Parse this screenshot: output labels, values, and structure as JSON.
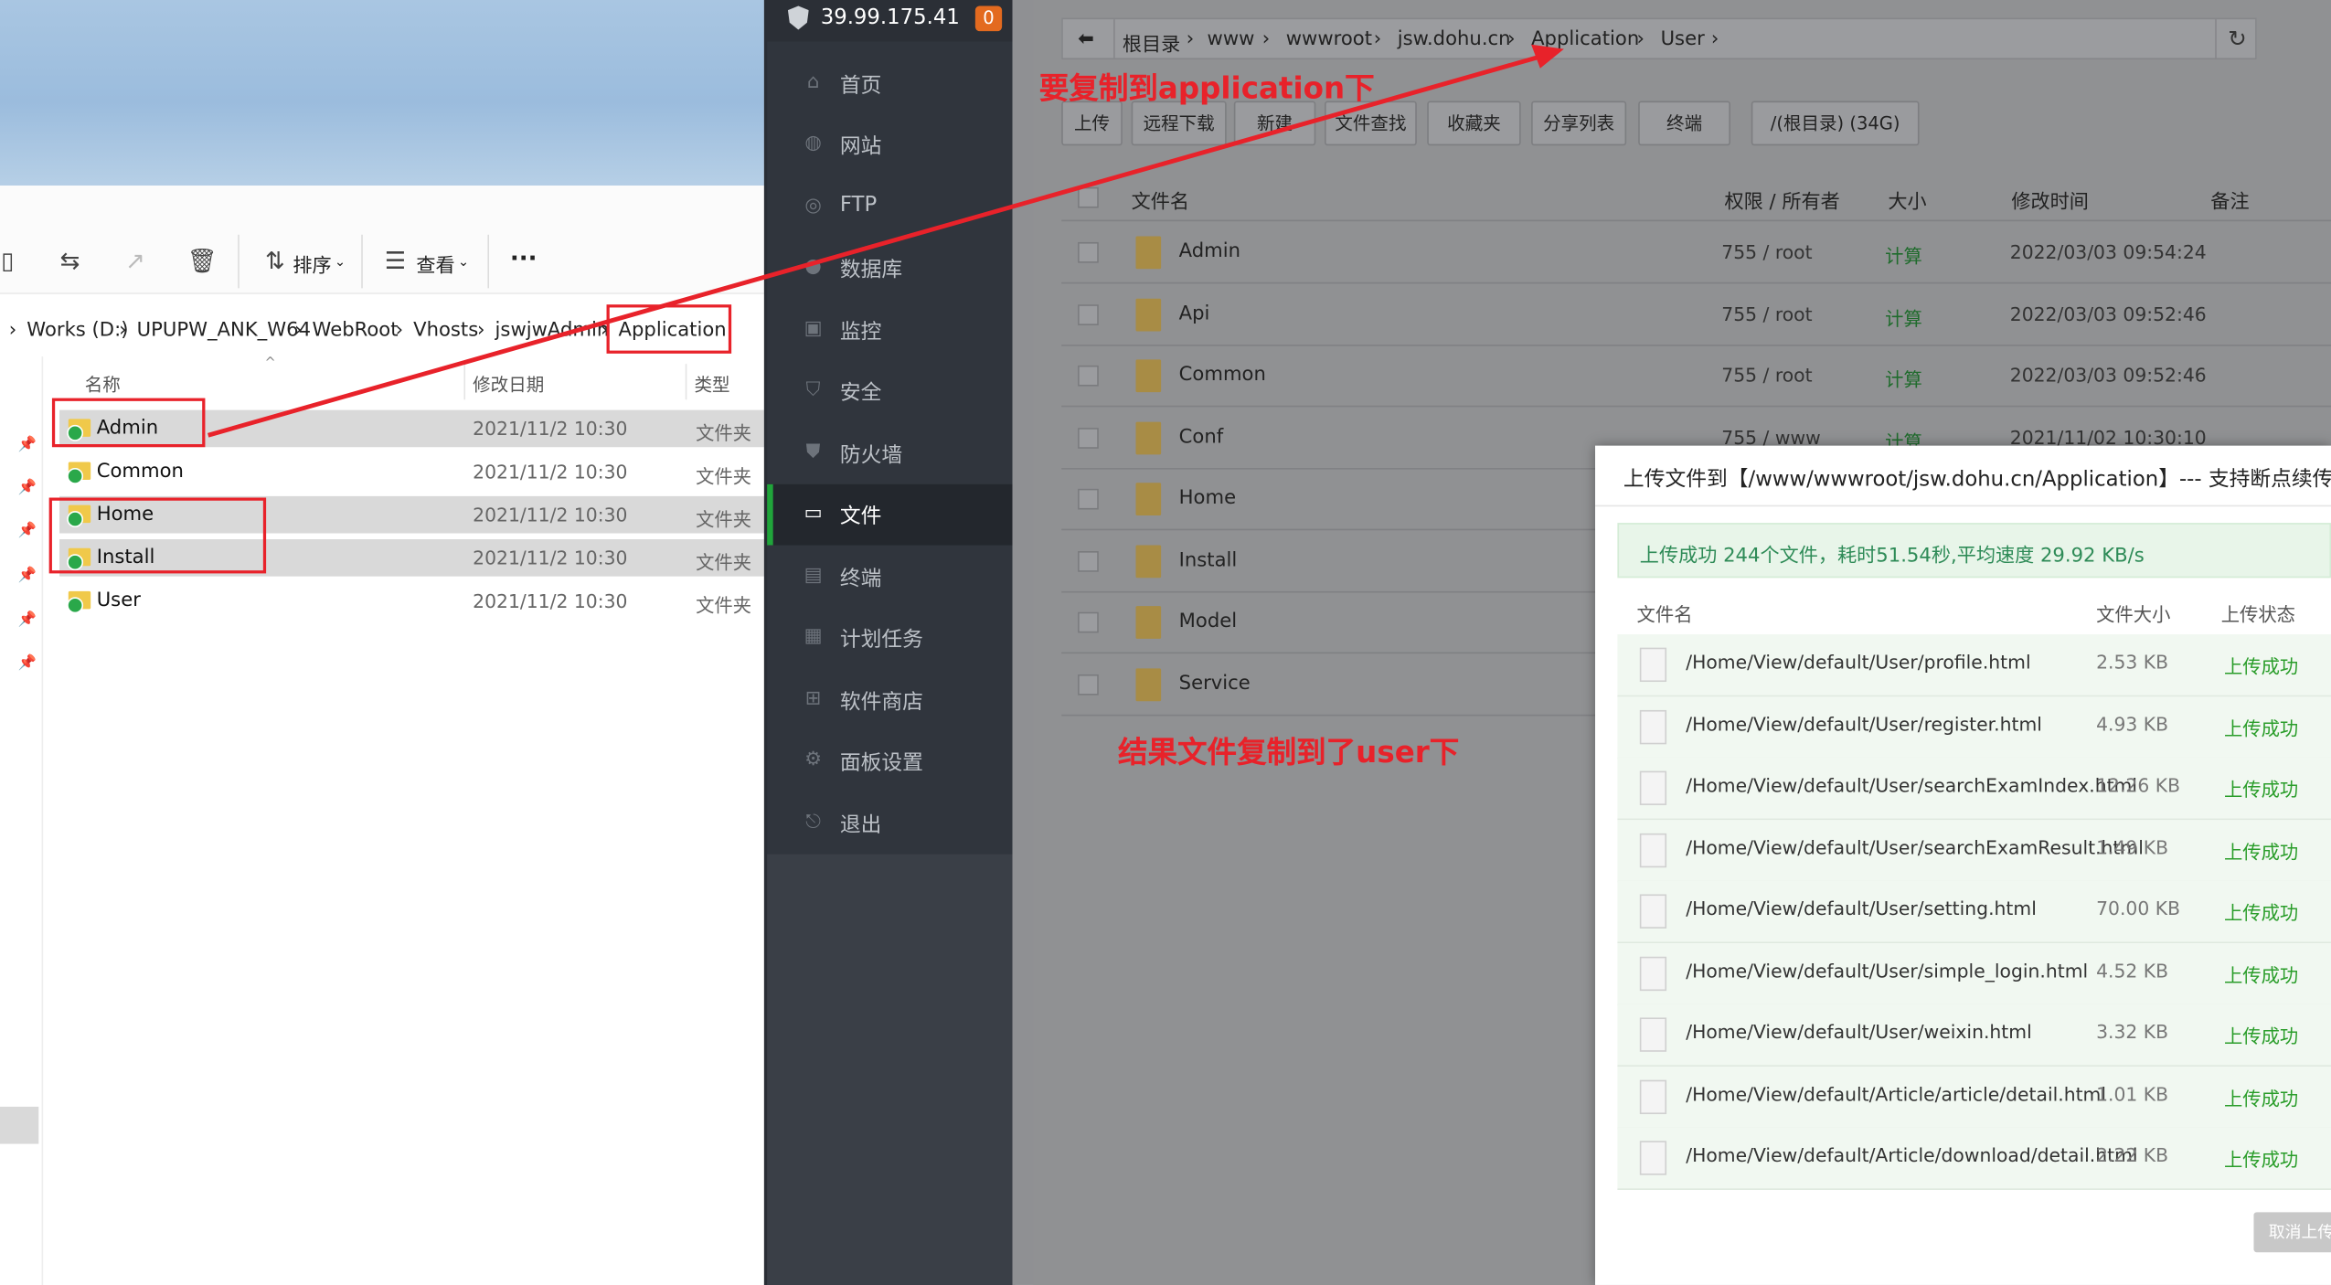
{
  "explorer": {
    "toolbar": {
      "sort_label": "排序",
      "view_label": "查看",
      "more_label": "···"
    },
    "address": [
      "Works (D:)",
      "UPUPW_ANK_W64",
      "WebRoot",
      "Vhosts",
      "jswjwAdmin",
      "Application"
    ],
    "columns": {
      "name": "名称",
      "date": "修改日期",
      "type": "类型"
    },
    "rows": [
      {
        "name": "Admin",
        "date": "2021/11/2 10:30",
        "type": "文件夹"
      },
      {
        "name": "Common",
        "date": "2021/11/2 10:30",
        "type": "文件夹"
      },
      {
        "name": "Home",
        "date": "2021/11/2 10:30",
        "type": "文件夹"
      },
      {
        "name": "Install",
        "date": "2021/11/2 10:30",
        "type": "文件夹"
      },
      {
        "name": "User",
        "date": "2021/11/2 10:30",
        "type": "文件夹"
      }
    ]
  },
  "panel": {
    "ip": "39.99.175.41",
    "badge": "0",
    "menu": [
      {
        "label": "首页",
        "icon": "home-icon"
      },
      {
        "label": "网站",
        "icon": "globe-icon"
      },
      {
        "label": "FTP",
        "icon": "ftp-icon"
      },
      {
        "label": "数据库",
        "icon": "database-icon"
      },
      {
        "label": "监控",
        "icon": "monitor-icon"
      },
      {
        "label": "安全",
        "icon": "shield-icon"
      },
      {
        "label": "防火墙",
        "icon": "firewall-icon"
      },
      {
        "label": "文件",
        "icon": "folder-icon"
      },
      {
        "label": "终端",
        "icon": "terminal-icon"
      },
      {
        "label": "计划任务",
        "icon": "calendar-icon"
      },
      {
        "label": "软件商店",
        "icon": "apps-icon"
      },
      {
        "label": "面板设置",
        "icon": "gear-icon"
      },
      {
        "label": "退出",
        "icon": "logout-icon"
      }
    ],
    "active_index": 7
  },
  "files": {
    "breadcrumb": [
      "根目录",
      "www",
      "wwwroot",
      "jsw.dohu.cn",
      "Application",
      "User"
    ],
    "buttons": {
      "upload": "上传",
      "remote": "远程下载",
      "new": "新建",
      "search": "文件查找",
      "fav": "收藏夹",
      "share": "分享列表",
      "terminal": "终端",
      "disk": "/(根目录) (34G)"
    },
    "columns": {
      "name": "文件名",
      "perm": "权限 / 所有者",
      "size": "大小",
      "mtime": "修改时间",
      "note": "备注"
    },
    "rows": [
      {
        "name": "Admin",
        "perm": "755 / root",
        "size": "计算",
        "mtime": "2022/03/03 09:54:24"
      },
      {
        "name": "Api",
        "perm": "755 / root",
        "size": "计算",
        "mtime": "2022/03/03 09:52:46"
      },
      {
        "name": "Common",
        "perm": "755 / root",
        "size": "计算",
        "mtime": "2022/03/03 09:52:46"
      },
      {
        "name": "Conf",
        "perm": "755 / www",
        "size": "计算",
        "mtime": "2021/11/02 10:30:10"
      },
      {
        "name": "Home",
        "perm": "",
        "size": "",
        "mtime": ""
      },
      {
        "name": "Install",
        "perm": "",
        "size": "",
        "mtime": ""
      },
      {
        "name": "Model",
        "perm": "",
        "size": "",
        "mtime": ""
      },
      {
        "name": "Service",
        "perm": "",
        "size": "",
        "mtime": ""
      }
    ]
  },
  "dialog": {
    "title": "上传文件到【/www/wwwroot/jsw.dohu.cn/Application】--- 支持断点续传",
    "success": "上传成功 244个文件，耗时51.54秒,平均速度 29.92 KB/s",
    "columns": {
      "name": "文件名",
      "size": "文件大小",
      "status": "上传状态"
    },
    "rows": [
      {
        "name": "/Home/View/default/User/profile.html",
        "size": "2.53 KB",
        "status": "上传成功"
      },
      {
        "name": "/Home/View/default/User/register.html",
        "size": "4.93 KB",
        "status": "上传成功"
      },
      {
        "name": "/Home/View/default/User/searchExamIndex.html",
        "size": "12.26 KB",
        "status": "上传成功"
      },
      {
        "name": "/Home/View/default/User/searchExamResult.html",
        "size": "1.49 KB",
        "status": "上传成功"
      },
      {
        "name": "/Home/View/default/User/setting.html",
        "size": "70.00 KB",
        "status": "上传成功"
      },
      {
        "name": "/Home/View/default/User/simple_login.html",
        "size": "4.52 KB",
        "status": "上传成功"
      },
      {
        "name": "/Home/View/default/User/weixin.html",
        "size": "3.32 KB",
        "status": "上传成功"
      },
      {
        "name": "/Home/View/default/Article/article/detail.html",
        "size": "1.01 KB",
        "status": "上传成功"
      },
      {
        "name": "/Home/View/default/Article/download/detail.html",
        "size": "2.22 KB",
        "status": "上传成功"
      }
    ],
    "cancel": "取消上传"
  },
  "annotations": {
    "top": "要复制到application下",
    "bottom": "结果文件复制到了user下",
    "color": "#e8222a"
  }
}
